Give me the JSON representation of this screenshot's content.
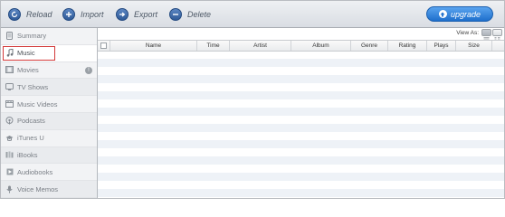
{
  "toolbar": {
    "reload_label": "Reload",
    "import_label": "Import",
    "export_label": "Export",
    "delete_label": "Delete",
    "upgrade_label": "upgrade"
  },
  "sidebar": {
    "items": [
      {
        "label": "Summary",
        "icon": "phone-icon"
      },
      {
        "label": "Music",
        "icon": "music-note-icon",
        "selected": true
      },
      {
        "label": "Movies",
        "icon": "film-icon",
        "badge": "!"
      },
      {
        "label": "TV Shows",
        "icon": "tv-icon"
      },
      {
        "label": "Music Videos",
        "icon": "music-video-icon"
      },
      {
        "label": "Podcasts",
        "icon": "podcast-icon"
      },
      {
        "label": "iTunes U",
        "icon": "graduation-cap-icon"
      },
      {
        "label": "iBooks",
        "icon": "books-icon"
      },
      {
        "label": "Audiobooks",
        "icon": "audiobook-icon"
      },
      {
        "label": "Voice Memos",
        "icon": "microphone-icon"
      }
    ]
  },
  "content": {
    "view_as_label": "View As:",
    "columns": [
      "Name",
      "Time",
      "Artist",
      "Album",
      "Genre",
      "Rating",
      "Plays",
      "Size"
    ]
  },
  "colors": {
    "accent_blue": "#2f5a98",
    "upgrade_blue": "#1e6fcc",
    "selection_outline": "#d33a3a",
    "row_stripe": "#eef2f7"
  }
}
